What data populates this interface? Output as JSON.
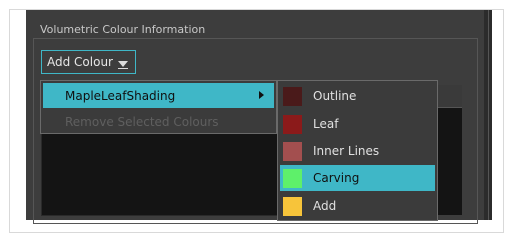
{
  "panel": {
    "group_title": "Volumetric Colour Information",
    "add_colour_label": "Add Colour"
  },
  "menu": {
    "items": [
      {
        "label": "MapleLeafShading",
        "state": "active",
        "has_submenu": true
      },
      {
        "label": "Remove Selected Colours",
        "state": "disabled",
        "has_submenu": false
      }
    ]
  },
  "submenu": {
    "items": [
      {
        "label": "Outline",
        "color": "#4a1a1a",
        "active": false
      },
      {
        "label": "Leaf",
        "color": "#8b1a1a",
        "active": false
      },
      {
        "label": "Inner Lines",
        "color": "#a34f4f",
        "active": false
      },
      {
        "label": "Carving",
        "color": "#5ef06a",
        "active": true
      },
      {
        "label": "Add",
        "color": "#f7c43a",
        "active": false
      }
    ]
  },
  "colors": {
    "accent": "#3fb7c7",
    "panel_bg": "#3d3d3d",
    "list_bg": "#141414"
  }
}
